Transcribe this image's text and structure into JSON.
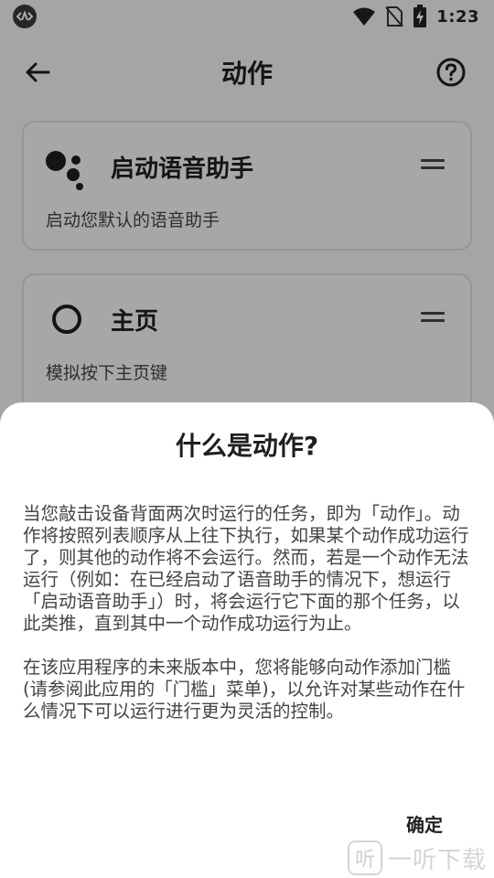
{
  "status_bar": {
    "app_icon": "cloud-link-icon",
    "time": "1:23",
    "icons": [
      "wifi-icon",
      "no-sim-icon",
      "battery-charging-icon"
    ]
  },
  "app_bar": {
    "title": "动作",
    "back_icon": "arrow-left-icon",
    "help_icon": "help-circle-icon"
  },
  "actions": [
    {
      "title": "启动语音助手",
      "description": "启动您默认的语音助手",
      "icon": "google-assistant-icon"
    },
    {
      "title": "主页",
      "description": "模拟按下主页键",
      "icon": "circle-home-icon"
    }
  ],
  "dialog": {
    "title": "什么是动作?",
    "paragraphs": [
      "当您敲击设备背面两次时运行的任务，即为「动作」。动作将按照列表顺序从上往下执行，如果某个动作成功运行了，则其他的动作将不会运行。然而，若是一个动作无法运行（例如：在已经启动了语音助手的情况下，想运行「启动语音助手」）时，将会运行它下面的那个任务，以此类推，直到其中一个动作成功运行为止。",
      "在该应用程序的未来版本中，您将能够向动作添加门槛(请参阅此应用的「门槛」菜单)，以允许对某些动作在什么情况下可以运行进行更为灵活的控制。"
    ],
    "confirm_label": "确定"
  },
  "watermark": {
    "badge": "听",
    "text": "一听下载"
  },
  "colors": {
    "background": "#f4f4f4",
    "scrim": "rgba(0,0,0,0.32)",
    "dialog_bg": "#ffffff",
    "text_primary": "#1e1e1e"
  }
}
